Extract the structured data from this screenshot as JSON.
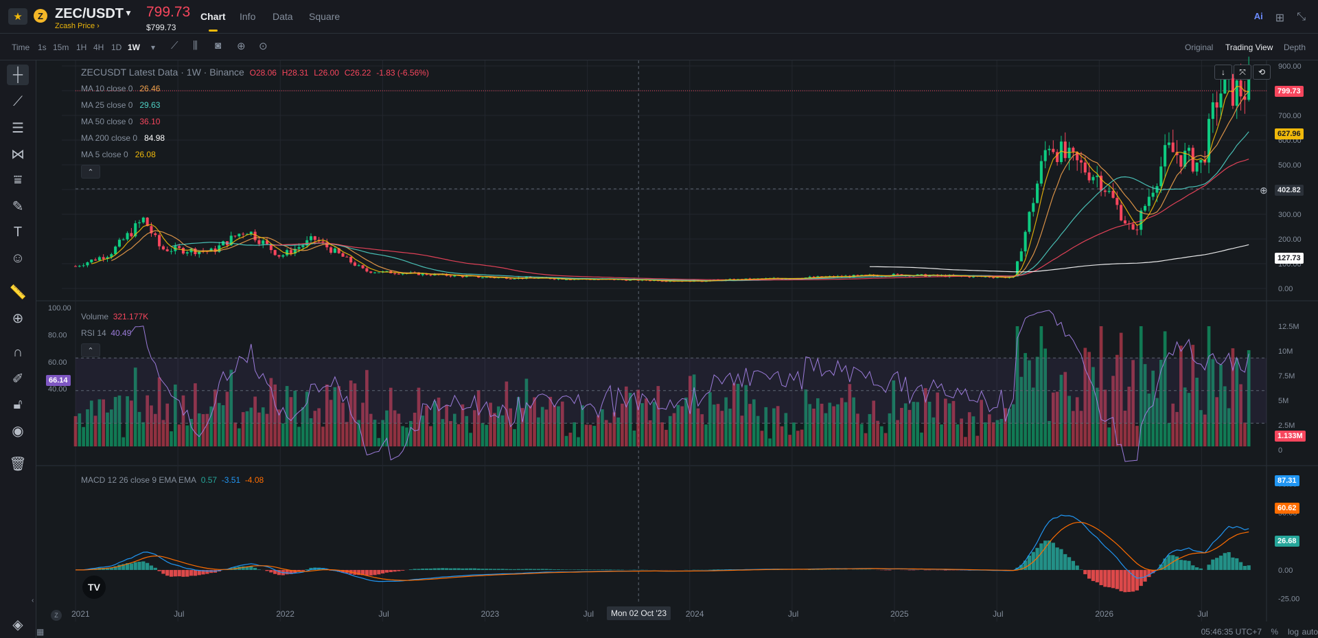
{
  "header": {
    "pair": "ZEC/USDT",
    "coin_glyph": "Z",
    "coin_name_link": "Zcash Price",
    "last_price": "799.73",
    "last_price_usd": "$799.73",
    "tabs": [
      {
        "label": "Chart",
        "active": true
      },
      {
        "label": "Info",
        "active": false
      },
      {
        "label": "Data",
        "active": false
      },
      {
        "label": "Square",
        "active": false
      }
    ],
    "right_icons": [
      "ai-icon",
      "grid-layout-icon",
      "collapse-icon"
    ]
  },
  "toolbar": {
    "time_label": "Time",
    "intervals": [
      "1s",
      "15m",
      "1H",
      "4H",
      "1D",
      "1W"
    ],
    "active_interval": "1W",
    "view_modes": [
      {
        "label": "Original",
        "active": false
      },
      {
        "label": "Trading View",
        "active": true
      },
      {
        "label": "Depth",
        "active": false
      }
    ]
  },
  "left_tools": [
    "crosshair-icon",
    "trend-line-icon",
    "horizontal-lines-icon",
    "pattern-icon",
    "fib-icon",
    "brush-icon",
    "text-icon",
    "emoji-icon",
    "ruler-icon",
    "zoom-in-icon",
    "magnet-icon",
    "lock-drawing-icon",
    "lock-icon",
    "eye-icon",
    "trash-icon",
    "layers-icon"
  ],
  "main_pane": {
    "series_title": "ZECUSDT Latest Data · 1W · Binance",
    "ohlc": {
      "open": "O28.06",
      "high": "H28.31",
      "low": "L26.00",
      "close": "C26.22",
      "change": "-1.83 (-6.56%)"
    },
    "ma_lines": [
      {
        "label": "MA 10 close 0",
        "value": "26.46",
        "color": "#f0a04b"
      },
      {
        "label": "MA 25 close 0",
        "value": "29.63",
        "color": "#4fd1c5"
      },
      {
        "label": "MA 50 close 0",
        "value": "36.10",
        "color": "#f6465d"
      },
      {
        "label": "MA 200 close 0",
        "value": "84.98",
        "color": "#ffffff"
      },
      {
        "label": "MA 5 close 0",
        "value": "26.08",
        "color": "#f0b90b"
      }
    ],
    "price_tags": [
      {
        "value": "799.73",
        "bg": "#f6465d",
        "fg": "#ffffff"
      },
      {
        "value": "627.96",
        "bg": "#f0b90b",
        "fg": "#181a20"
      },
      {
        "value": "402.82",
        "bg": "#2b3139",
        "fg": "#eaecef"
      },
      {
        "value": "127.73",
        "bg": "#ffffff",
        "fg": "#181a20"
      }
    ]
  },
  "volume_pane": {
    "volume_label": "Volume",
    "volume_value": "321.177K",
    "rsi_label": "RSI 14",
    "rsi_value": "40.49",
    "rsi_tag": "66.14",
    "volume_tag": "1.133M"
  },
  "macd_pane": {
    "label": "MACD 12 26 close 9 EMA EMA",
    "values": [
      "0.57",
      "-3.51",
      "-4.08"
    ],
    "value_colors": [
      "#26a69a",
      "#2196f3",
      "#ff6d00"
    ],
    "tags": [
      {
        "value": "87.31",
        "bg": "#2196f3"
      },
      {
        "value": "60.62",
        "bg": "#ff6d00"
      },
      {
        "value": "26.68",
        "bg": "#26a69a"
      }
    ]
  },
  "x_axis": {
    "labels": [
      "2021",
      "Jul",
      "2022",
      "Jul",
      "2023",
      "Jul",
      "2024",
      "Jul",
      "2025",
      "Jul",
      "2026",
      "Jul"
    ],
    "crosshair_label": "Mon 02 Oct '23"
  },
  "bottom_bar": {
    "time": "05:46:35 UTC+7",
    "options": [
      "%",
      "log",
      "auto"
    ]
  },
  "chart_data": {
    "type": "candlestick",
    "title": "ZECUSDT Latest Data · 1W · Binance",
    "price_axis_ticks": [
      "900.00",
      "800.00",
      "700.00",
      "600.00",
      "500.00",
      "400.00",
      "300.00",
      "200.00",
      "100.00",
      "0.00"
    ],
    "volume_axis_ticks": [
      "12.5M",
      "10M",
      "7.5M",
      "5M",
      "2.5M",
      "0"
    ],
    "rsi_axis_ticks": [
      "100.00",
      "80.00",
      "60.00",
      "40.00"
    ],
    "macd_axis_ticks": [
      "75.00",
      "50.00",
      "25.00",
      "0.00",
      "-25.00"
    ],
    "x_range": [
      "2021-01",
      "2026-09"
    ],
    "price_ylim": [
      0,
      900
    ],
    "approx_close_path": [
      {
        "x": "2021-01",
        "y": 90
      },
      {
        "x": "2021-03",
        "y": 140
      },
      {
        "x": "2021-05",
        "y": 280
      },
      {
        "x": "2021-06",
        "y": 160
      },
      {
        "x": "2021-09",
        "y": 150
      },
      {
        "x": "2021-11",
        "y": 240
      },
      {
        "x": "2022-01",
        "y": 130
      },
      {
        "x": "2022-03",
        "y": 200
      },
      {
        "x": "2022-06",
        "y": 70
      },
      {
        "x": "2023-01",
        "y": 45
      },
      {
        "x": "2024-01",
        "y": 30
      },
      {
        "x": "2025-01",
        "y": 55
      },
      {
        "x": "2025-08",
        "y": 45
      },
      {
        "x": "2025-10",
        "y": 600
      },
      {
        "x": "2025-11",
        "y": 530
      },
      {
        "x": "2026-01",
        "y": 450
      },
      {
        "x": "2026-03",
        "y": 220
      },
      {
        "x": "2026-05",
        "y": 560
      },
      {
        "x": "2026-07",
        "y": 500
      },
      {
        "x": "2026-08",
        "y": 799.73
      }
    ]
  }
}
